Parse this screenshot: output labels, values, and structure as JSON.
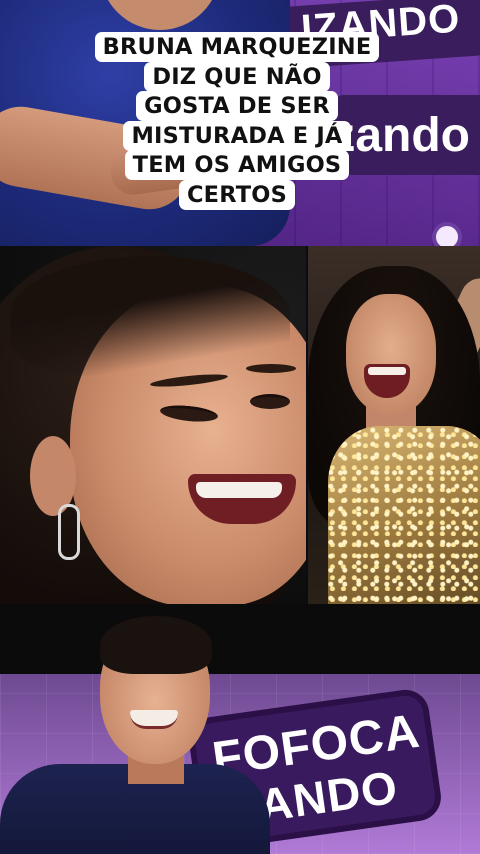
{
  "caption": {
    "lines": [
      "BRUNA MARQUEZINE",
      "DIZ QUE NÃO",
      "GOSTA DE SER",
      "MISTURADA E JÁ",
      "TEM OS AMIGOS",
      "CERTOS"
    ]
  },
  "top_panel": {
    "logo_line_1": "IZANDO",
    "logo_line_2": "zando"
  },
  "bottom_panel": {
    "logo_line_1": "FOFOCA",
    "logo_line_2": "IZANDO"
  }
}
